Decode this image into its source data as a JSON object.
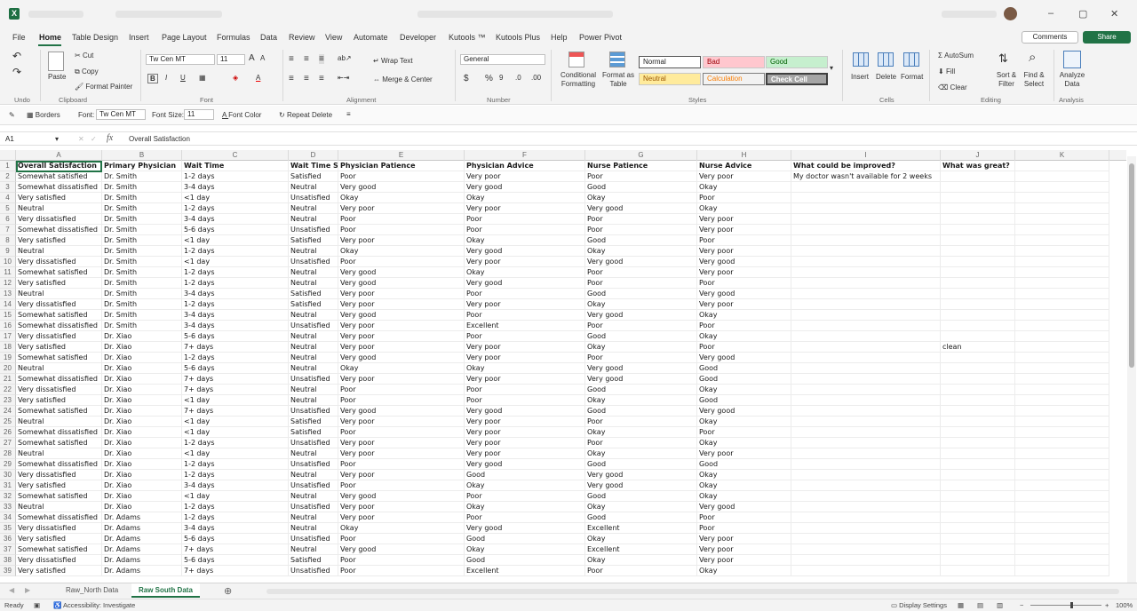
{
  "title_bar": {
    "app_icon": "excel-icon",
    "avatar": "user-avatar"
  },
  "ribbon_tabs": [
    "File",
    "Home",
    "Table Design",
    "Insert",
    "Page Layout",
    "Formulas",
    "Data",
    "Review",
    "View",
    "Automate",
    "Developer",
    "Kutools ™",
    "Kutools Plus",
    "Help",
    "Power Pivot"
  ],
  "comments_label": "Comments",
  "share_label": "Share",
  "ribbon": {
    "undo_group": "Undo",
    "clipboard": {
      "paste": "Paste",
      "cut": "Cut",
      "copy": "Copy",
      "format_painter": "Format Painter",
      "group": "Clipboard"
    },
    "font": {
      "name": "Tw Cen MT",
      "size": "11",
      "group": "Font"
    },
    "alignment": {
      "wrap": "Wrap Text",
      "merge": "Merge & Center",
      "group": "Alignment"
    },
    "number": {
      "format": "General",
      "group": "Number"
    },
    "styles": {
      "conditional": "Conditional Formatting",
      "format_table": "Format as Table",
      "normal": "Normal",
      "bad": "Bad",
      "good": "Good",
      "neutral": "Neutral",
      "calculation": "Calculation",
      "check_cell": "Check Cell",
      "group": "Styles"
    },
    "cells": {
      "insert": "Insert",
      "delete": "Delete",
      "format": "Format",
      "group": "Cells"
    },
    "editing": {
      "autosum": "AutoSum",
      "fill": "Fill",
      "clear": "Clear",
      "sort": "Sort & Filter",
      "find": "Find & Select",
      "group": "Editing"
    },
    "analysis": {
      "analyze": "Analyze Data",
      "group": "Analysis"
    }
  },
  "qat": {
    "borders": "Borders",
    "font_label": "Font:",
    "font_value": "Tw Cen MT",
    "size_label": "Font Size:",
    "size_value": "11",
    "font_color": "Font Color",
    "repeat_delete": "Repeat Delete"
  },
  "formula_bar": {
    "name_box": "A1",
    "fx": "fx",
    "value": "Overall Satisfaction"
  },
  "columns": [
    "A",
    "B",
    "C",
    "D",
    "E",
    "F",
    "G",
    "H",
    "I",
    "J",
    "K"
  ],
  "headers": [
    "Overall Satisfaction",
    "Primary Physician",
    "Wait Time",
    "Wait Time Sa",
    "Physician Patience",
    "Physician Advice",
    "Nurse Patience",
    "Nurse Advice",
    "What could be improved?",
    "What was great?"
  ],
  "rows": [
    [
      "Somewhat satisfied",
      "Dr. Smith",
      "1-2 days",
      "Satisfied",
      "Poor",
      "Very poor",
      "Poor",
      "Very poor",
      "My doctor wasn't available for 2 weeks",
      ""
    ],
    [
      "Somewhat dissatisfied",
      "Dr. Smith",
      "3-4 days",
      "Neutral",
      "Very good",
      "Very good",
      "Good",
      "Okay",
      "",
      ""
    ],
    [
      "Very satisfied",
      "Dr. Smith",
      "<1 day",
      "Unsatisfied",
      "Okay",
      "Okay",
      "Okay",
      "Poor",
      "",
      ""
    ],
    [
      "Neutral",
      "Dr. Smith",
      "1-2 days",
      "Neutral",
      "Very poor",
      "Very poor",
      "Very good",
      "Okay",
      "",
      ""
    ],
    [
      "Very dissatisfied",
      "Dr. Smith",
      "3-4 days",
      "Neutral",
      "Poor",
      "Poor",
      "Poor",
      "Very poor",
      "",
      ""
    ],
    [
      "Somewhat dissatisfied",
      "Dr. Smith",
      "5-6 days",
      "Unsatisfied",
      "Poor",
      "Poor",
      "Poor",
      "Very poor",
      "",
      ""
    ],
    [
      "Very satisfied",
      "Dr. Smith",
      "<1 day",
      "Satisfied",
      "Very poor",
      "Okay",
      "Good",
      "Poor",
      "",
      ""
    ],
    [
      "Neutral",
      "Dr. Smith",
      "1-2 days",
      "Neutral",
      "Okay",
      "Very good",
      "Okay",
      "Very poor",
      "",
      ""
    ],
    [
      "Very dissatisfied",
      "Dr. Smith",
      "<1 day",
      "Unsatisfied",
      "Poor",
      "Very poor",
      "Very good",
      "Very good",
      "",
      ""
    ],
    [
      "Somewhat satisfied",
      "Dr. Smith",
      "1-2 days",
      "Neutral",
      "Very good",
      "Okay",
      "Poor",
      "Very poor",
      "",
      ""
    ],
    [
      "Very satisfied",
      "Dr. Smith",
      "1-2 days",
      "Neutral",
      "Very good",
      "Very good",
      "Poor",
      "Poor",
      "",
      ""
    ],
    [
      "Neutral",
      "Dr. Smith",
      "3-4 days",
      "Satisfied",
      "Very poor",
      "Poor",
      "Good",
      "Very good",
      "",
      ""
    ],
    [
      "Very dissatisfied",
      "Dr. Smith",
      "1-2 days",
      "Satisfied",
      "Very poor",
      "Very poor",
      "Okay",
      "Very poor",
      "",
      ""
    ],
    [
      "Somewhat satisfied",
      "Dr. Smith",
      "3-4 days",
      "Neutral",
      "Very good",
      "Poor",
      "Very good",
      "Okay",
      "",
      ""
    ],
    [
      "Somewhat dissatisfied",
      "Dr. Smith",
      "3-4 days",
      "Unsatisfied",
      "Very poor",
      "Excellent",
      "Poor",
      "Poor",
      "",
      ""
    ],
    [
      "Very dissatisfied",
      "Dr. Xiao",
      "5-6 days",
      "Neutral",
      "Very poor",
      "Poor",
      "Good",
      "Okay",
      "",
      ""
    ],
    [
      "Very satisfied",
      "Dr. Xiao",
      "7+ days",
      "Neutral",
      "Very poor",
      "Very poor",
      "Okay",
      "Poor",
      "",
      "clean"
    ],
    [
      "Somewhat satisfied",
      "Dr. Xiao",
      "1-2 days",
      "Neutral",
      "Very good",
      "Very poor",
      "Poor",
      "Very good",
      "",
      ""
    ],
    [
      "Neutral",
      "Dr. Xiao",
      "5-6 days",
      "Neutral",
      "Okay",
      "Okay",
      "Very good",
      "Good",
      "",
      ""
    ],
    [
      "Somewhat dissatisfied",
      "Dr. Xiao",
      "7+ days",
      "Unsatisfied",
      "Very poor",
      "Very poor",
      "Very good",
      "Good",
      "",
      ""
    ],
    [
      "Very dissatisfied",
      "Dr. Xiao",
      "7+ days",
      "Neutral",
      "Poor",
      "Poor",
      "Good",
      "Okay",
      "",
      ""
    ],
    [
      "Very satisfied",
      "Dr. Xiao",
      "<1 day",
      "Neutral",
      "Poor",
      "Poor",
      "Okay",
      "Good",
      "",
      ""
    ],
    [
      "Somewhat satisfied",
      "Dr. Xiao",
      "7+ days",
      "Unsatisfied",
      "Very good",
      "Very good",
      "Good",
      "Very good",
      "",
      ""
    ],
    [
      "Neutral",
      "Dr. Xiao",
      "<1 day",
      "Satisfied",
      "Very poor",
      "Very poor",
      "Poor",
      "Okay",
      "",
      ""
    ],
    [
      "Somewhat dissatisfied",
      "Dr. Xiao",
      "<1 day",
      "Satisfied",
      "Poor",
      "Very poor",
      "Okay",
      "Poor",
      "",
      ""
    ],
    [
      "Somewhat satisfied",
      "Dr. Xiao",
      "1-2 days",
      "Unsatisfied",
      "Very poor",
      "Very poor",
      "Poor",
      "Okay",
      "",
      ""
    ],
    [
      "Neutral",
      "Dr. Xiao",
      "<1 day",
      "Neutral",
      "Very poor",
      "Very poor",
      "Okay",
      "Very poor",
      "",
      ""
    ],
    [
      "Somewhat dissatisfied",
      "Dr. Xiao",
      "1-2 days",
      "Unsatisfied",
      "Poor",
      "Very good",
      "Good",
      "Good",
      "",
      ""
    ],
    [
      "Very dissatisfied",
      "Dr. Xiao",
      "1-2 days",
      "Neutral",
      "Very poor",
      "Good",
      "Very good",
      "Okay",
      "",
      ""
    ],
    [
      "Very satisfied",
      "Dr. Xiao",
      "3-4 days",
      "Unsatisfied",
      "Poor",
      "Okay",
      "Very good",
      "Okay",
      "",
      ""
    ],
    [
      "Somewhat satisfied",
      "Dr. Xiao",
      "<1 day",
      "Neutral",
      "Very good",
      "Poor",
      "Good",
      "Okay",
      "",
      ""
    ],
    [
      "Neutral",
      "Dr. Xiao",
      "1-2 days",
      "Unsatisfied",
      "Very poor",
      "Okay",
      "Okay",
      "Very good",
      "",
      ""
    ],
    [
      "Somewhat dissatisfied",
      "Dr. Adams",
      "1-2 days",
      "Neutral",
      "Very poor",
      "Poor",
      "Good",
      "Poor",
      "",
      ""
    ],
    [
      "Very dissatisfied",
      "Dr. Adams",
      "3-4 days",
      "Neutral",
      "Okay",
      "Very good",
      "Excellent",
      "Poor",
      "",
      ""
    ],
    [
      "Very satisfied",
      "Dr. Adams",
      "5-6 days",
      "Unsatisfied",
      "Poor",
      "Good",
      "Okay",
      "Very poor",
      "",
      ""
    ],
    [
      "Somewhat satisfied",
      "Dr. Adams",
      "7+ days",
      "Neutral",
      "Very good",
      "Okay",
      "Excellent",
      "Very poor",
      "",
      ""
    ],
    [
      "Very dissatisfied",
      "Dr. Adams",
      "5-6 days",
      "Satisfied",
      "Poor",
      "Good",
      "Okay",
      "Very poor",
      "",
      ""
    ],
    [
      "Very satisfied",
      "Dr. Adams",
      "7+ days",
      "Unsatisfied",
      "Poor",
      "Excellent",
      "Poor",
      "Okay",
      "",
      ""
    ]
  ],
  "sheets": [
    "Raw_North Data",
    "Raw South Data"
  ],
  "status": {
    "ready": "Ready",
    "accessibility": "Accessibility: Investigate",
    "display_settings": "Display Settings",
    "zoom": "100%"
  }
}
